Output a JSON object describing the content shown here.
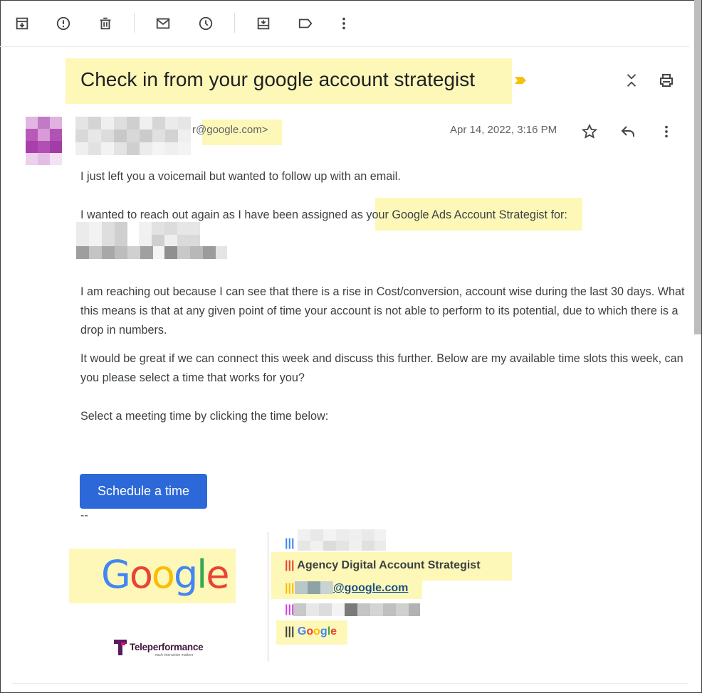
{
  "toolbar": {
    "icons": [
      "archive-icon",
      "report-spam-icon",
      "delete-icon",
      "mark-unread-icon",
      "snooze-icon",
      "move-to-icon",
      "label-icon",
      "more-icon"
    ]
  },
  "email": {
    "subject": "Check in from your google account strategist",
    "sender_address": "r@google.com>",
    "date": "Apr 14, 2022, 3:16 PM",
    "paragraph1": "I just left you a voicemail but wanted to follow up with an email.",
    "paragraph2_before": "I wanted to reach out again as I have been assigned a",
    "paragraph2_highlight": "s your Google Ads Account Strategist",
    "paragraph2_after": " for:",
    "paragraph3": "I am reaching out because I can see that there is a rise in Cost/conversion, account wise during the last 30 days. What this means is that at any given point of time your account is not able to perform to its potential, due to which there is a drop in numbers.",
    "paragraph4": "It would be great if we can connect this week and discuss this further. Below are my available time slots this week, can you please select a time that works for you?",
    "paragraph5": "Select a meeting time by clicking the time below:",
    "schedule_button": "Schedule a time",
    "dashes": "--"
  },
  "signature": {
    "google_logo": "Google",
    "teleperformance_logo": "Teleperformance",
    "teleperformance_tagline": "each interaction matters",
    "bars": "|||",
    "title": "Agency Digital Account Strategist",
    "email_suffix": "@google.com",
    "company": "Google"
  },
  "colors": {
    "highlight": "#fdf8b8",
    "button": "#2d68d8",
    "google_blue": "#4285f4",
    "google_red": "#ea4335",
    "google_yellow": "#fbbc05",
    "google_green": "#34a853"
  }
}
